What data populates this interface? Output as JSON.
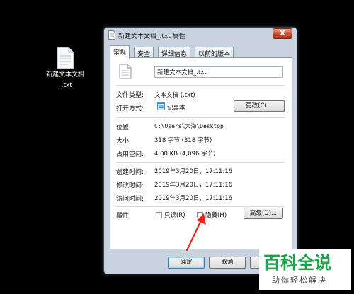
{
  "desktop": {
    "icon": "text-file-icon",
    "file_label_line1": "新建文本文档",
    "file_label_line2": "_.txt"
  },
  "window": {
    "title": "新建文本文档_.txt 属性",
    "close_label": "X"
  },
  "tabs": [
    {
      "label": "常规",
      "active": true
    },
    {
      "label": "安全",
      "active": false
    },
    {
      "label": "详细信息",
      "active": false
    },
    {
      "label": "以前的版本",
      "active": false
    }
  ],
  "general": {
    "file_name": "新建文本文档_.txt",
    "file_type_label": "文件类型:",
    "file_type_value": "文本文档 (.txt)",
    "opens_with_label": "打开方式:",
    "opens_with_value": "记事本",
    "change_button": "更改(C)...",
    "location_label": "位置:",
    "location_value": "C:\\Users\\大海\\Desktop",
    "size_label": "大小:",
    "size_value": "318 字节 (318 字节)",
    "size_on_disk_label": "占用空间:",
    "size_on_disk_value": "4.00 KB (4,096 字节)",
    "created_label": "创建时间:",
    "created_value": "2019年3月20日，17:11:16",
    "modified_label": "修改时间:",
    "modified_value": "2019年3月20日，17:11:16",
    "accessed_label": "访问时间:",
    "accessed_value": "2019年3月20日，17:11:16",
    "attributes_label": "属性:",
    "readonly_label": "只读(R)",
    "readonly_checked": false,
    "hidden_label": "隐藏(H)",
    "hidden_checked": false,
    "advanced_button": "高级(D)..."
  },
  "footer": {
    "ok": "确定",
    "cancel": "取消",
    "apply": "应"
  },
  "watermark": {
    "title": "百科全说",
    "subtitle": "助你轻松解决"
  },
  "colors": {
    "annotation_arrow": "#e8231c",
    "watermark_green": "#1aa34a"
  }
}
